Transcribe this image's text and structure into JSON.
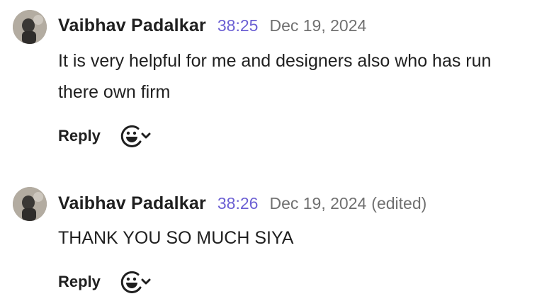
{
  "comments": [
    {
      "author": "Vaibhav Padalkar",
      "timestamp": "38:25",
      "date": "Dec 19, 2024",
      "edited": "",
      "text": "It is very helpful for me and designers also who has run there own firm",
      "reply_label": "Reply",
      "reaction_icon": "add-reaction-icon"
    },
    {
      "author": "Vaibhav Padalkar",
      "timestamp": "38:26",
      "date": "Dec 19, 2024",
      "edited": "(edited)",
      "text": "THANK YOU SO MUCH SIYA",
      "reply_label": "Reply",
      "reaction_icon": "add-reaction-icon"
    }
  ],
  "colors": {
    "timestamp": "#6b5fd3",
    "date": "#707070",
    "text": "#1f1f1f"
  }
}
